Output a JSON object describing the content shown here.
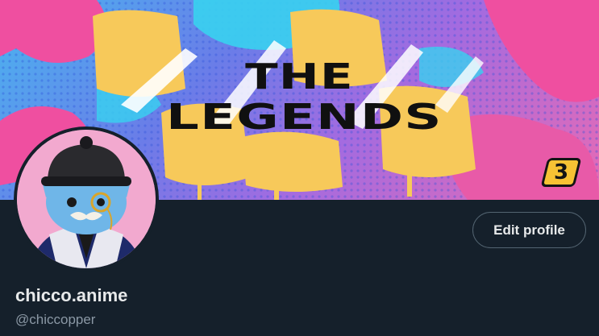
{
  "banner": {
    "line1": "THE",
    "line2": "LEGENDS",
    "badge": "3"
  },
  "profile": {
    "display_name": "chicco.anime",
    "handle": "@chiccopper",
    "edit_button_label": "Edit profile"
  },
  "colors": {
    "page_bg": "#15202b",
    "primary_text": "#e7e9ea",
    "secondary_text": "#8b98a5",
    "button_border": "#536471",
    "banner_yellow": "#f7c234",
    "banner_pink": "#ef4fa0",
    "banner_cyan": "#38d2f0"
  },
  "icons": {
    "avatar": "cartoon-cat-avatar"
  }
}
